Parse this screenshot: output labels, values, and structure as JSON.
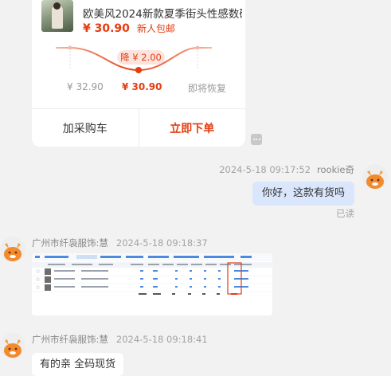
{
  "product_card": {
    "title": "欧美风2024新款夏季街头性感数码",
    "price": "¥ 30.90",
    "price_tag": "新人包邮",
    "price_graph": {
      "drop_badge": "降 ¥ 2.00",
      "original_price": "¥ 32.90",
      "current_price": "¥ 30.90",
      "restore_label": "即将恢复"
    },
    "buttons": {
      "add_cart": "加采购车",
      "order_now": "立即下单"
    }
  },
  "messages": [
    {
      "sender": "rookie奇",
      "time": "2024-5-18 09:17:52",
      "text": "你好，这款有货吗",
      "status": "已读"
    },
    {
      "sender": "广州市纤袅服饰:慧",
      "time": "2024-5-18 09:18:37",
      "attachment": "screenshot"
    },
    {
      "sender": "广州市纤袅服饰:慧",
      "time": "2024-5-18 09:18:41",
      "text": "有的亲  全码现货"
    }
  ],
  "colors": {
    "accent": "#e43d11",
    "my_bubble": "#d9e6fb",
    "background": "#f2f2f2"
  }
}
